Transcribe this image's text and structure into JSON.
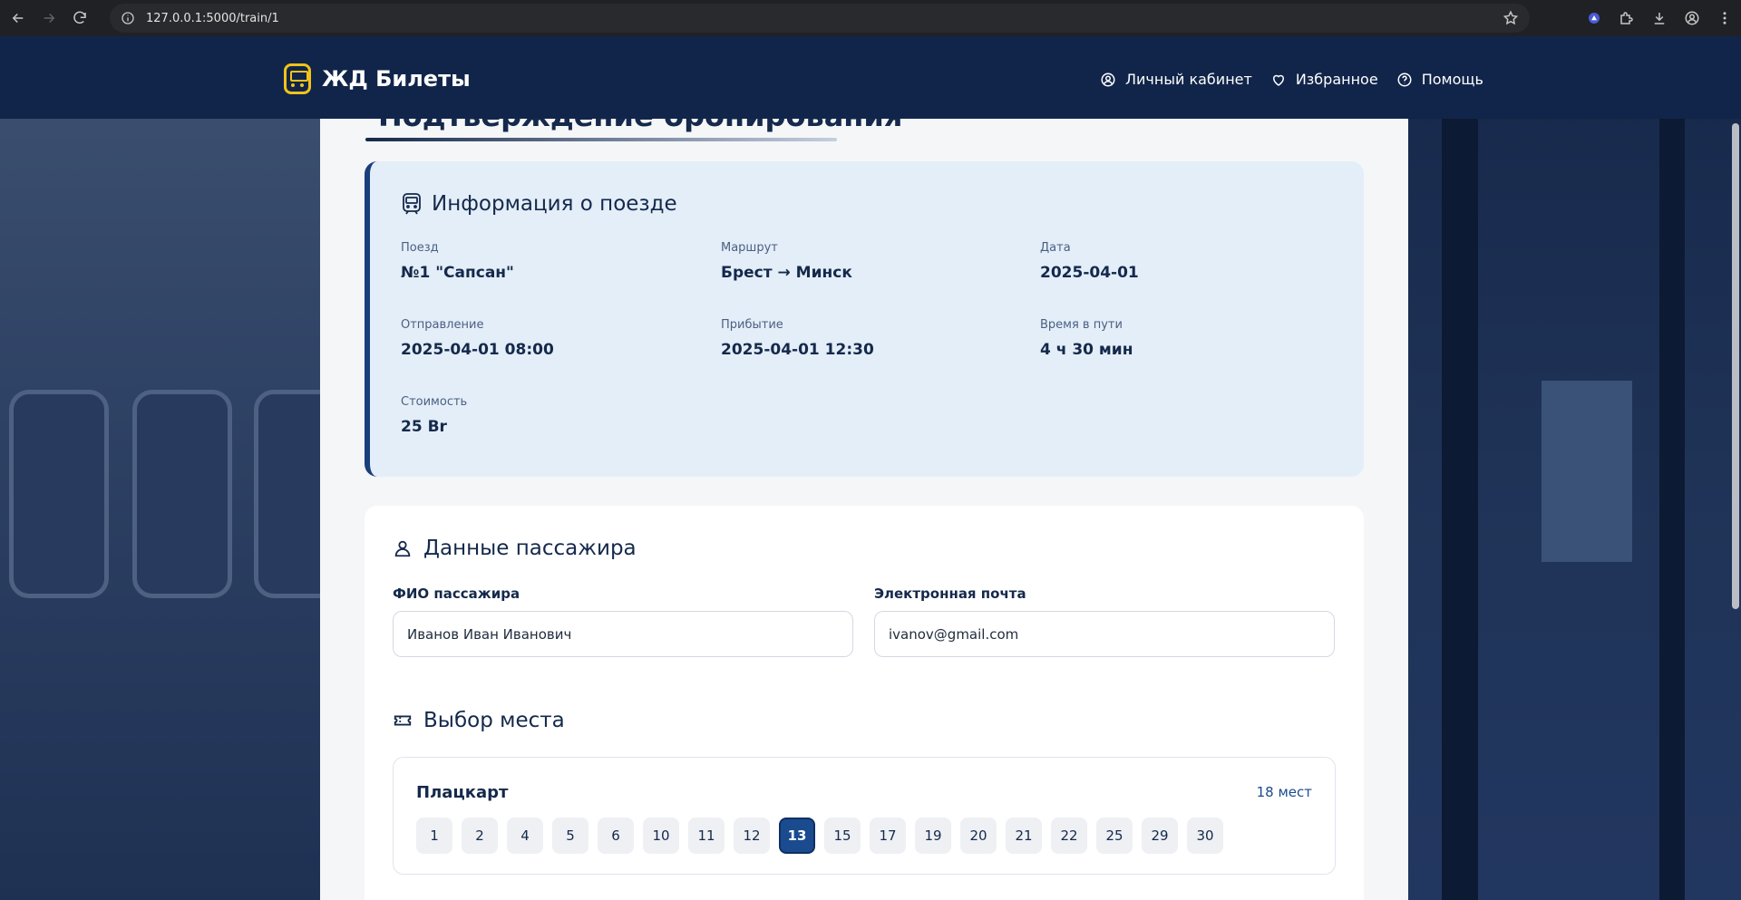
{
  "browser": {
    "url": "127.0.0.1:5000/train/1"
  },
  "header": {
    "brand": "ЖД Билеты",
    "nav": [
      {
        "label": "Личный кабинет",
        "icon": "user-circle-icon"
      },
      {
        "label": "Избранное",
        "icon": "heart-icon"
      },
      {
        "label": "Помощь",
        "icon": "help-circle-icon"
      }
    ]
  },
  "page": {
    "title": "Подтверждение бронирования"
  },
  "train_info": {
    "title": "Информация о поезде",
    "fields": [
      {
        "label": "Поезд",
        "value": "№1 \"Сапсан\""
      },
      {
        "label": "Маршрут",
        "value": "Брест → Минск"
      },
      {
        "label": "Дата",
        "value": "2025-04-01"
      },
      {
        "label": "Отправление",
        "value": "2025-04-01 08:00"
      },
      {
        "label": "Прибытие",
        "value": "2025-04-01 12:30"
      },
      {
        "label": "Время в пути",
        "value": "4 ч 30 мин"
      },
      {
        "label": "Стоимость",
        "value": "25 Br"
      }
    ]
  },
  "passenger": {
    "title": "Данные пассажира",
    "name_label": "ФИО пассажира",
    "name_value": "Иванов Иван Иванович",
    "email_label": "Электронная почта",
    "email_value": "ivanov@gmail.com"
  },
  "seat_selection": {
    "title": "Выбор места",
    "coach_type": "Плацкарт",
    "seat_count": "18 мест",
    "seats": [
      "1",
      "2",
      "4",
      "5",
      "6",
      "10",
      "11",
      "12",
      "13",
      "15",
      "17",
      "19",
      "20",
      "21",
      "22",
      "25",
      "29",
      "30"
    ],
    "selected_seat": "13"
  },
  "colors": {
    "header_bg": "#11254a",
    "accent": "#1b4b8f",
    "brand_icon": "#f2c318",
    "info_card_bg": "#e4eef8"
  }
}
